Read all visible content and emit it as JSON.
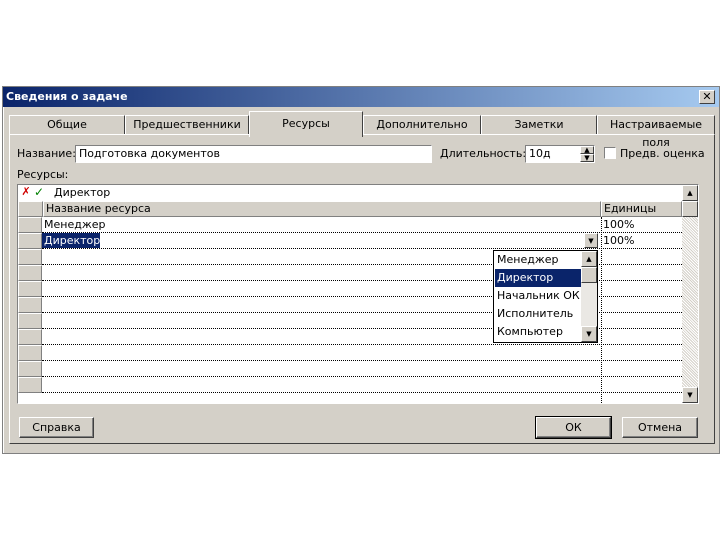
{
  "window": {
    "title": "Сведения о задаче",
    "close": "✕"
  },
  "tabs": [
    {
      "label": "Общие"
    },
    {
      "label": "Предшественники"
    },
    {
      "label": "Ресурсы"
    },
    {
      "label": "Дополнительно"
    },
    {
      "label": "Заметки"
    },
    {
      "label": "Настраиваемые поля"
    }
  ],
  "form": {
    "name_label": "Название:",
    "name_value": "Подготовка документов",
    "duration_label": "Длительность:",
    "duration_value": "10д",
    "estimate_label": "Предв. оценка",
    "resources_label": "Ресурсы:"
  },
  "grid": {
    "edit_value": "Директор",
    "columns": {
      "name": "Название ресурса",
      "units": "Единицы"
    },
    "rows": [
      {
        "name": "Менеджер",
        "units": "100%"
      },
      {
        "name": "Директор",
        "units": "100%"
      }
    ]
  },
  "dropdown": {
    "items": [
      "Менеджер",
      "Директор",
      "Начальник ОК",
      "Исполнитель",
      "Компьютер"
    ],
    "selected": "Директор"
  },
  "buttons": {
    "help": "Справка",
    "ok": "ОК",
    "cancel": "Отмена"
  }
}
